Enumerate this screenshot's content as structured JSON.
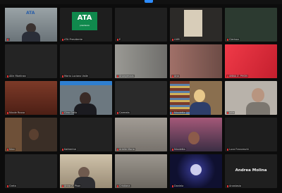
{
  "meeting": {
    "top_bar_color": "#2d8cff",
    "speaker_border_color": "#d9c36a"
  },
  "tiles": [
    {
      "name": "",
      "icon": "person-video",
      "speaker": true,
      "logo": "ATA"
    },
    {
      "name": "ATA Presidente",
      "icon": "logo-ata",
      "logo_big": "ATA",
      "logo_small": "presidenza"
    },
    {
      "name": "E",
      "icon": "camera-off"
    },
    {
      "name": "LNM",
      "icon": "person-video"
    },
    {
      "name": "Clarissa",
      "icon": "camera-off"
    },
    {
      "name": "Allie Martinez",
      "icon": "camera-off"
    },
    {
      "name": "Mario Luciano Valle",
      "icon": "camera-off"
    },
    {
      "name": "Anonymous",
      "icon": "person-video"
    },
    {
      "name": "Ana",
      "icon": "person-video"
    },
    {
      "name": "ANNA Z. PHON",
      "icon": "person-video"
    },
    {
      "name": "Nicole Russo",
      "icon": "person-video"
    },
    {
      "name": "Gina Gallo",
      "icon": "person-video"
    },
    {
      "name": "Carmela",
      "icon": "camera-off"
    },
    {
      "name": "Nicoletta",
      "icon": "person-video"
    },
    {
      "name": "Julia",
      "icon": "person-video"
    },
    {
      "name": "Nico",
      "icon": "person-video"
    },
    {
      "name": "Katherine",
      "icon": "camera-off"
    },
    {
      "name": "Arielle Mario",
      "icon": "person-video"
    },
    {
      "name": "Nicoletta",
      "icon": "person-video"
    },
    {
      "name": "Luca Franceschi",
      "icon": "camera-off"
    },
    {
      "name": "Greta",
      "icon": "person-video"
    },
    {
      "name": "Anna Z. Phon",
      "icon": "person-video"
    },
    {
      "name": "Cristiana",
      "icon": "camera-off"
    },
    {
      "name": "Daniela",
      "icon": "person-video"
    },
    {
      "name": "Anastasia",
      "icon": "camera-off",
      "big_name": "Andrea Molina"
    }
  ]
}
